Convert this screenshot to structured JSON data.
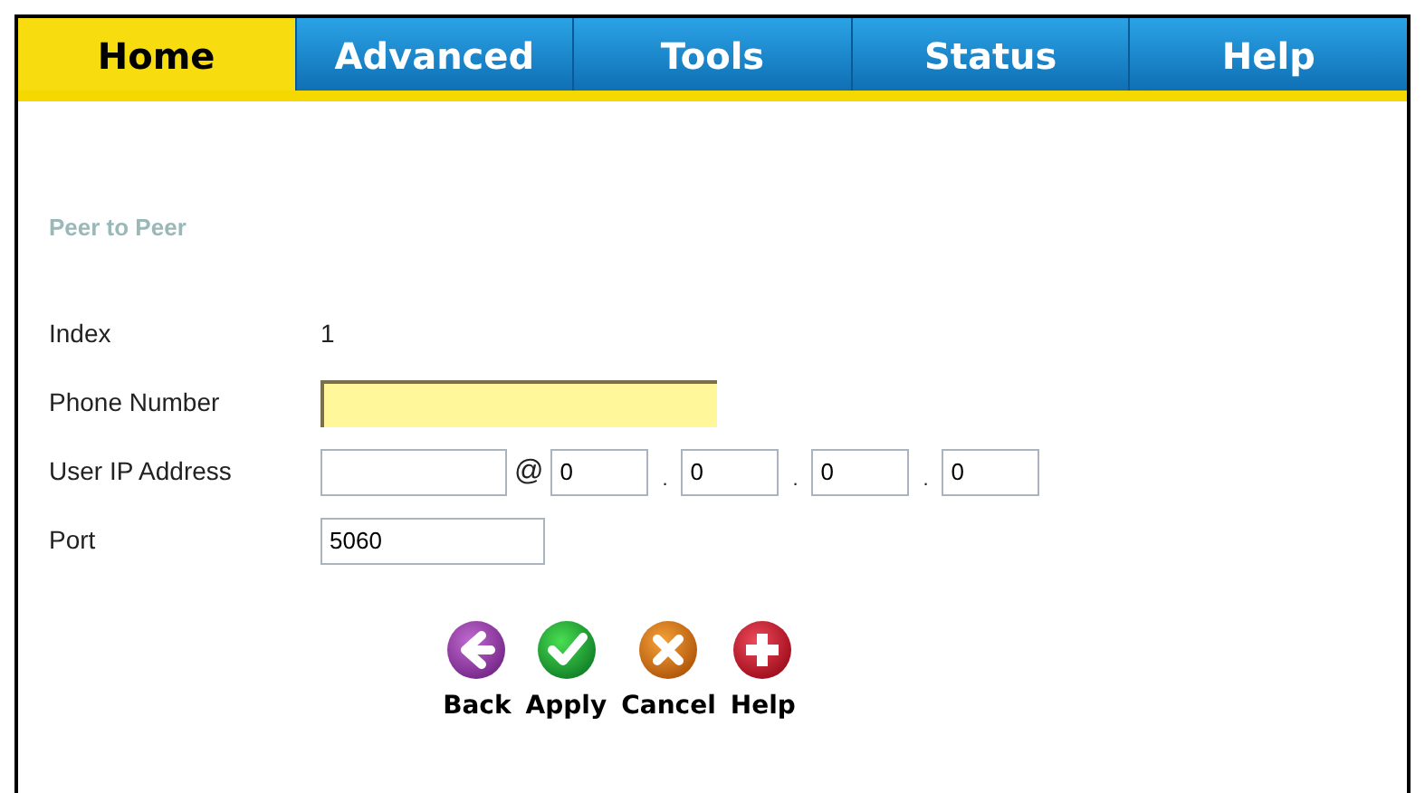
{
  "tabs": [
    {
      "label": "Home",
      "selected": true
    },
    {
      "label": "Advanced",
      "selected": false
    },
    {
      "label": "Tools",
      "selected": false
    },
    {
      "label": "Status",
      "selected": false
    },
    {
      "label": "Help",
      "selected": false
    }
  ],
  "section_title": "Peer to Peer",
  "form": {
    "index": {
      "label": "Index",
      "value": "1"
    },
    "phone_number": {
      "label": "Phone Number"
    },
    "user_ip": {
      "label": "User IP Address",
      "at": "@",
      "octets": [
        "0",
        "0",
        "0",
        "0"
      ],
      "separators": [
        ".",
        ".",
        "."
      ]
    },
    "port": {
      "label": "Port",
      "value": "5060"
    }
  },
  "actions": [
    {
      "kind": "back",
      "label": "Back"
    },
    {
      "kind": "apply",
      "label": "Apply"
    },
    {
      "kind": "cancel",
      "label": "Cancel"
    },
    {
      "kind": "help",
      "label": "Help"
    }
  ]
}
